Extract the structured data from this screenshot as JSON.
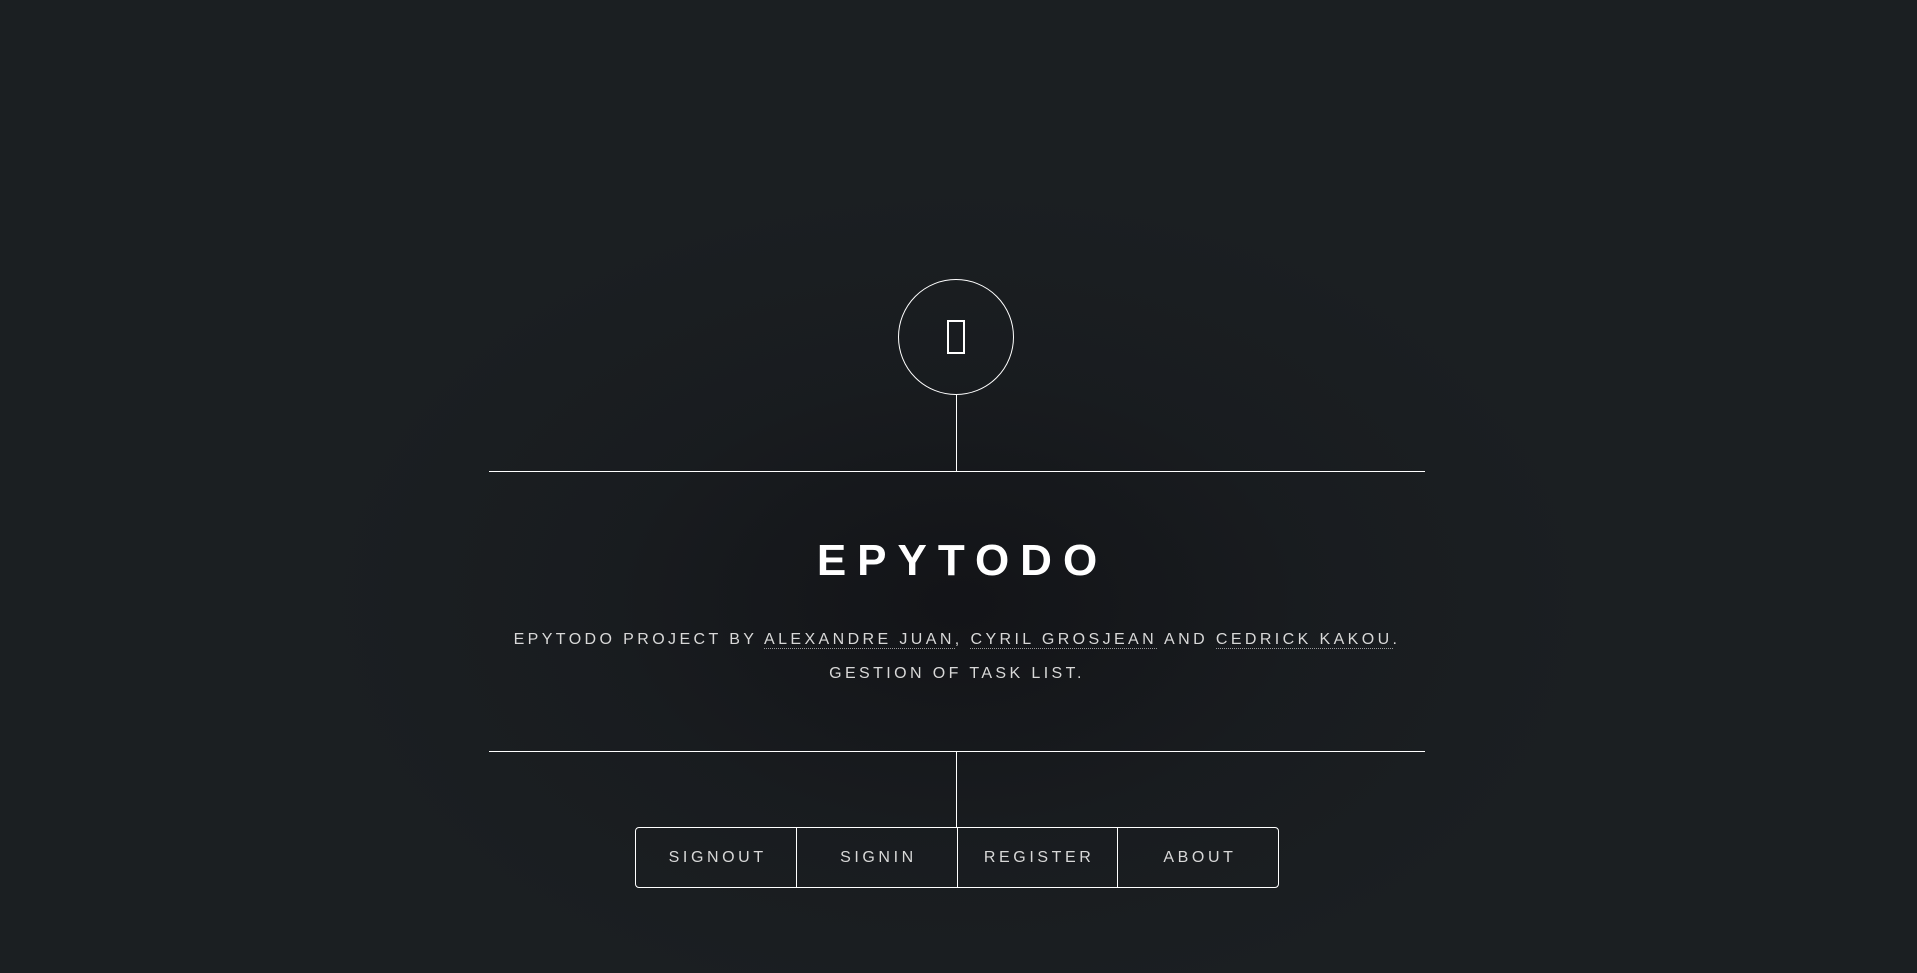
{
  "header": {
    "logo_icon": "diamond-icon",
    "title": "EPYTODO",
    "description": {
      "prefix": "EPYTODO PROJECT BY ",
      "authors": [
        "ALEXANDRE JUAN",
        "CYRIL GROSJEAN",
        "CEDRICK KAKOU"
      ],
      "sep1": ", ",
      "sep2": " AND ",
      "end": ".",
      "line2": "GESTION OF TASK LIST."
    }
  },
  "nav": {
    "items": [
      {
        "label": "SIGNOUT"
      },
      {
        "label": "SIGNIN"
      },
      {
        "label": "REGISTER"
      },
      {
        "label": "ABOUT"
      }
    ]
  },
  "colors": {
    "background": "#1b1f22",
    "foreground": "#ffffff",
    "muted_text": "#d8d8d8"
  }
}
